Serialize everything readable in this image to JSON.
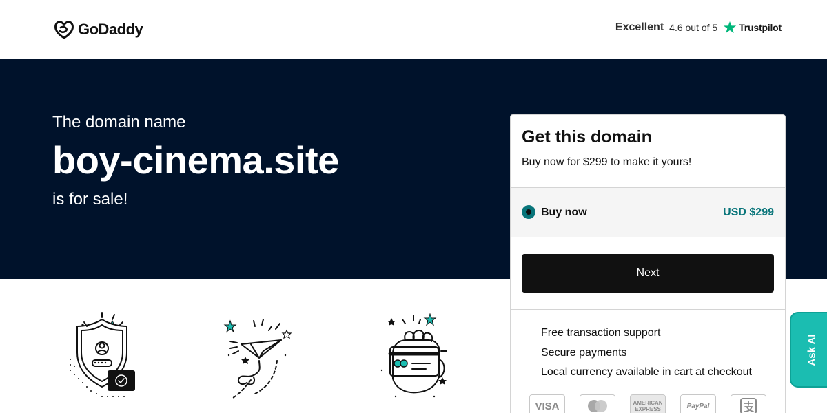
{
  "header": {
    "logo_text": "GoDaddy",
    "rating_word": "Excellent",
    "rating_score": "4.6 out of 5",
    "trustpilot_text": "Trustpilot"
  },
  "hero": {
    "pre": "The domain name",
    "domain": "boy-cinema.site",
    "post": "is for sale!"
  },
  "card": {
    "title": "Get this domain",
    "subtitle": "Buy now for $299 to make it yours!",
    "option": {
      "label": "Buy now",
      "price": "USD $299",
      "selected": true
    },
    "next_label": "Next",
    "features": [
      "Free transaction support",
      "Secure payments",
      "Local currency available in cart at checkout"
    ],
    "payments": {
      "visa": "VISA",
      "amex": "AMERICAN EXPRESS",
      "paypal": "PayPal"
    }
  },
  "ask_ai": {
    "label": "Ask AI"
  },
  "colors": {
    "hero_bg": "#00122b",
    "accent_teal": "#09757a",
    "ask_ai_bg": "#1bbdb1",
    "trustpilot_green": "#00b67a"
  },
  "icons": [
    "godaddy-logo-icon",
    "trustpilot-star-icon",
    "shield-user-icon",
    "paper-plane-icon",
    "card-hand-icon",
    "visa-icon",
    "mastercard-icon",
    "amex-icon",
    "paypal-icon",
    "alipay-icon"
  ]
}
